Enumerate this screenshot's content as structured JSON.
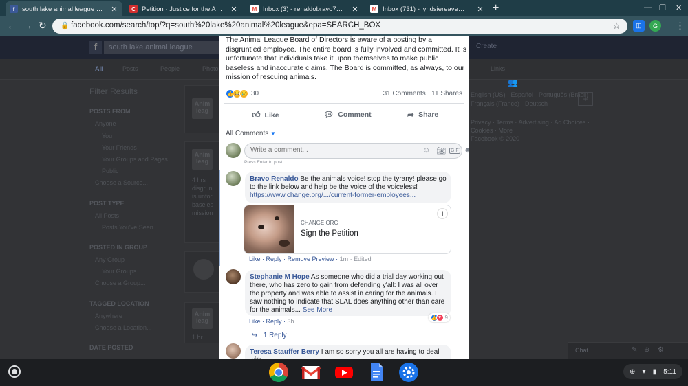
{
  "browser": {
    "tabs": [
      {
        "title": "south lake animal league - Faceb",
        "icon": "facebook-icon",
        "color": "#3b5998"
      },
      {
        "title": "Petition · Justice for the Animals",
        "icon": "change-org-icon",
        "color": "#d32f2f"
      },
      {
        "title": "Inbox (3) - renaldobravo7@gmai",
        "icon": "gmail-icon",
        "color": "#ea4335"
      },
      {
        "title": "Inbox (731) - lyndsiereaves@gm",
        "icon": "gmail-icon",
        "color": "#ea4335"
      }
    ],
    "url": "facebook.com/search/top/?q=south%20lake%20animal%20league&epa=SEARCH_BOX"
  },
  "facebook": {
    "search_value": "south lake animal league",
    "create_label": "Create",
    "tabs": [
      "All",
      "Posts",
      "People",
      "Photos",
      "Links"
    ],
    "filter_title": "Filter Results",
    "filters": [
      {
        "heading": "POSTS FROM",
        "options": [
          "Anyone",
          "You",
          "Your Friends",
          "Your Groups and Pages",
          "Public",
          "Choose a Source..."
        ]
      },
      {
        "heading": "POST TYPE",
        "options": [
          "All Posts",
          "Posts You've Seen"
        ]
      },
      {
        "heading": "POSTED IN GROUP",
        "options": [
          "Any Group",
          "Your Groups",
          "Choose a Group..."
        ]
      },
      {
        "heading": "TAGGED LOCATION",
        "options": [
          "Anywhere",
          "Choose a Location..."
        ]
      },
      {
        "heading": "DATE POSTED",
        "options": []
      }
    ],
    "bg_post_snippets": [
      "4 hrs",
      "disgrun",
      "is unfor",
      "baseles",
      "mission",
      "1 hr"
    ],
    "right_col": [
      "English (US) · Español · Português (Brasil)",
      "Français (France) · Deutsch",
      "Privacy · Terms · Advertising · Ad Choices ·",
      "Cookies · More",
      "Facebook © 2020"
    ],
    "chat_label": "Chat"
  },
  "post": {
    "body": "The Animal League Board of Directors is aware of a posting by a disgruntled employee. The entire board is fully involved and committed. It is unfortunate that individuals take it upon themselves to make public baseless and inaccurate claims. The Board is committed, as always, to our mission of rescuing animals.",
    "reaction_count": "30",
    "comments_count": "31 Comments",
    "shares_count": "11 Shares",
    "like_label": "Like",
    "comment_label": "Comment",
    "share_label": "Share",
    "all_comments_label": "All Comments",
    "comment_placeholder": "Write a comment...",
    "enter_hint": "Press Enter to post."
  },
  "comments": [
    {
      "author": "Bravo Renaldo",
      "text": "Be the animals voice! stop the tyrany! please go to the link below and help be the voice of the voiceless!",
      "link": "https://www.change.org/.../current-former-employees...",
      "preview": {
        "domain": "CHANGE.ORG",
        "title": "Sign the Petition",
        "info": "i"
      },
      "actions": [
        "Like",
        "Reply",
        "Remove Preview"
      ],
      "time": "1m",
      "edited": "Edited"
    },
    {
      "author": "Stephanie M Hope",
      "text": "As someone who did a trial day working out there, who has zero to gain from defending y'all: I was all over the property and was able to assist in caring for the animals. I saw nothing to indicate that SLAL does anything other than care for the animals...",
      "see_more": "See More",
      "actions": [
        "Like",
        "Reply"
      ],
      "time": "3h",
      "reaction_count": "9",
      "replies": "1 Reply"
    },
    {
      "author": "Teresa Stauffer Berry",
      "text": "I am so sorry you all are having to deal with"
    }
  ],
  "system": {
    "time": "5:11"
  }
}
